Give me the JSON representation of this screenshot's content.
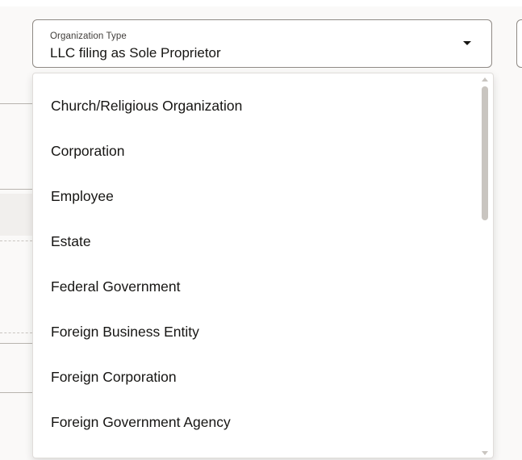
{
  "select": {
    "label": "Organization Type",
    "value": "LLC filing as Sole Proprietor"
  },
  "dropdown": {
    "options": [
      "Church/Religious Organization",
      "Corporation",
      "Employee",
      "Estate",
      "Federal Government",
      "Foreign Business Entity",
      "Foreign Corporation",
      "Foreign Government Agency"
    ]
  },
  "colors": {
    "border": "#8f8a85",
    "text": "#161513",
    "scrollbar": "#c9c5c0"
  }
}
